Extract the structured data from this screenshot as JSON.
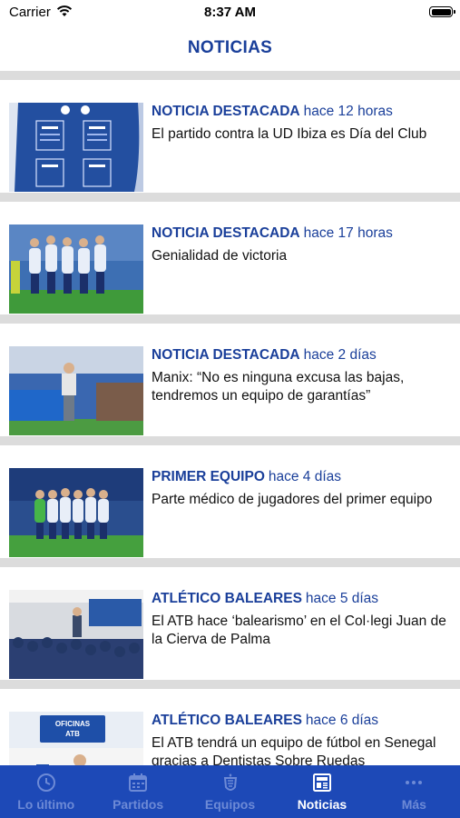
{
  "status_bar": {
    "carrier": "Carrier",
    "time": "8:37 AM",
    "battery_level": 1.0
  },
  "header": {
    "title": "NOTICIAS"
  },
  "news": [
    {
      "category": "NOTICIA DESTACADA",
      "time": "hace 12 horas",
      "headline": "El partido contra la UD Ibiza es Día del Club"
    },
    {
      "category": "NOTICIA DESTACADA",
      "time": "hace 17 horas",
      "headline": "Genialidad de victoria"
    },
    {
      "category": "NOTICIA DESTACADA",
      "time": "hace 2 días",
      "headline": "Manix: “No es ninguna excusa las bajas, tendremos un equipo de garantías”"
    },
    {
      "category": "PRIMER EQUIPO",
      "time": "hace 4 días",
      "headline": "Parte médico de jugadores del primer equipo"
    },
    {
      "category": "ATLÉTICO BALEARES",
      "time": "hace 5 días",
      "headline": "El ATB hace ‘balearismo’ en el Col·legi Juan de la Cierva de Palma"
    },
    {
      "category": "ATLÉTICO BALEARES",
      "time": "hace 6 días",
      "headline": "El ATB tendrá un equipo de fútbol en Senegal gracias a Dentistas Sobre Ruedas",
      "image_sign": "OFICINAS ATB"
    }
  ],
  "tabs": [
    {
      "label": "Lo último",
      "icon": "clock-icon"
    },
    {
      "label": "Partidos",
      "icon": "calendar-icon"
    },
    {
      "label": "Equipos",
      "icon": "crest-icon"
    },
    {
      "label": "Noticias",
      "icon": "newspaper-icon"
    },
    {
      "label": "Más",
      "icon": "more-icon"
    }
  ],
  "colors": {
    "brand_blue": "#1a3f9a",
    "tab_bar": "#1d49b7",
    "tab_inactive": "#6d8ad6",
    "separator": "#dcdcdc"
  }
}
